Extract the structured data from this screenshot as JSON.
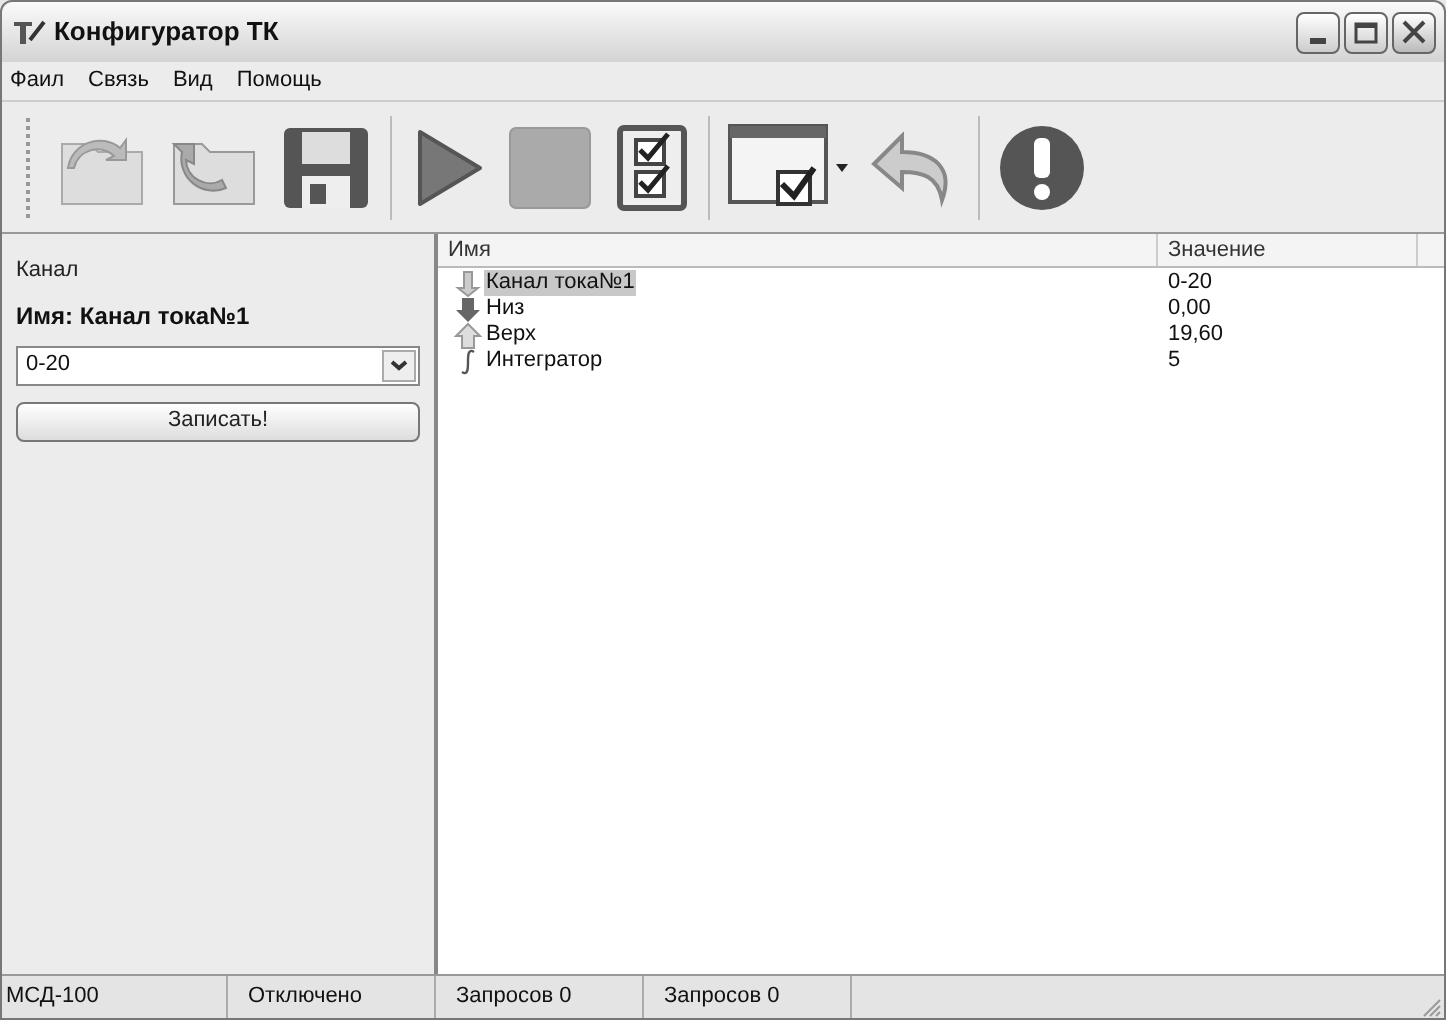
{
  "window": {
    "title": "Конфигуратор ТК"
  },
  "menu": [
    "Фаил",
    "Связь",
    "Вид",
    "Помощь"
  ],
  "toolbar": [
    {
      "kind": "folder-in"
    },
    {
      "kind": "folder-out"
    },
    {
      "kind": "floppy"
    },
    {
      "kind": "play"
    },
    {
      "kind": "stop"
    },
    {
      "kind": "checklist"
    },
    {
      "kind": "window-check"
    },
    {
      "kind": "undo"
    },
    {
      "kind": "alert"
    }
  ],
  "left_panel": {
    "section": "Канал",
    "name_label": "Имя: Канал тока№1",
    "dropdown": {
      "value": "0-20"
    },
    "button": "Записать!"
  },
  "table": {
    "columns": [
      "Имя",
      "Значение"
    ],
    "rows": [
      {
        "kind": "channel",
        "name": "Канал тока№1",
        "value": "0-20",
        "selected": true
      },
      {
        "kind": "down",
        "name": "Низ",
        "value": "0,00",
        "selected": false
      },
      {
        "kind": "up",
        "name": "Верх",
        "value": "19,60",
        "selected": false
      },
      {
        "kind": "integral",
        "name": "Интегратор",
        "value": "5",
        "selected": false
      }
    ]
  },
  "status_bar": [
    "МСД-100",
    "Отключено",
    "Запросов 0",
    "Запросов 0"
  ]
}
